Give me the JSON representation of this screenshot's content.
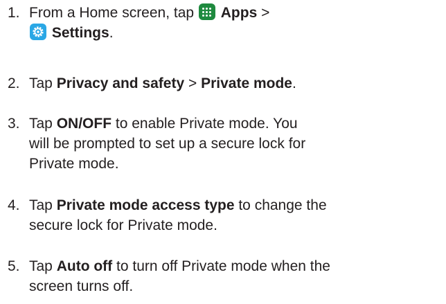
{
  "steps": [
    {
      "number": "1.",
      "line1_prefix": "From a Home screen, tap ",
      "apps_label": "Apps",
      "sep": " >",
      "settings_label": "Settings",
      "period": ".",
      "apps_icon": "apps-grid-icon",
      "settings_icon": "settings-gear-icon"
    },
    {
      "number": "2.",
      "prefix": "Tap ",
      "bold1": "Privacy and safety",
      "sep": " > ",
      "bold2": "Private mode",
      "suffix": "."
    },
    {
      "number": "3.",
      "prefix": "Tap ",
      "bold": "ON/OFF",
      "line1_rest": " to enable Private mode. You",
      "line2": "will be prompted to set up a secure lock for",
      "line3": "Private mode."
    },
    {
      "number": "4.",
      "prefix": "Tap ",
      "bold": "Private mode access type",
      "line1_rest": " to change the",
      "line2": "secure lock for Private mode."
    },
    {
      "number": "5.",
      "prefix": "Tap ",
      "bold": "Auto off",
      "line1_rest": " to turn off Private mode when the",
      "line2": "screen turns off."
    }
  ],
  "colors": {
    "text": "#231f20",
    "apps_icon_bg": "#1f8a3f",
    "settings_icon_bg": "#2aa7e5"
  }
}
